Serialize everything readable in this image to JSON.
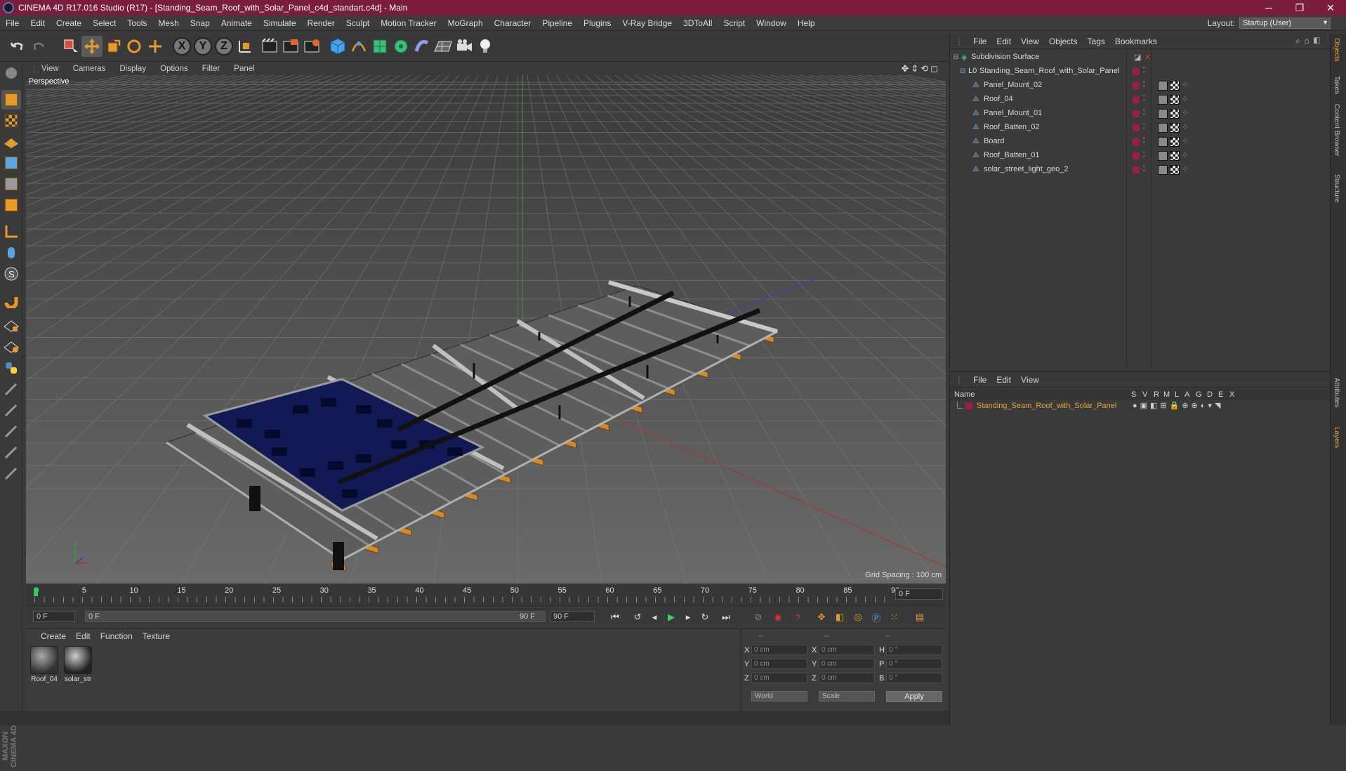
{
  "window": {
    "title": "CINEMA 4D R17.016 Studio (R17) - [Standing_Seam_Roof_with_Solar_Panel_c4d_standart.c4d] - Main",
    "controls": [
      "─",
      "❐",
      "✕"
    ]
  },
  "menu": [
    "File",
    "Edit",
    "Create",
    "Select",
    "Tools",
    "Mesh",
    "Snap",
    "Animate",
    "Simulate",
    "Render",
    "Sculpt",
    "Motion Tracker",
    "MoGraph",
    "Character",
    "Pipeline",
    "Plugins",
    "V-Ray Bridge",
    "3DToAll",
    "Script",
    "Window",
    "Help"
  ],
  "layout": {
    "label": "Layout:",
    "value": "Startup (User)"
  },
  "viewport": {
    "menu": [
      "View",
      "Cameras",
      "Display",
      "Options",
      "Filter",
      "Panel"
    ],
    "camera_label": "Perspective",
    "grid_spacing": "Grid Spacing : 100 cm",
    "nav_icons": "✥⇕⟲◻"
  },
  "timeline": {
    "ticks": [
      "0",
      "5",
      "10",
      "15",
      "20",
      "25",
      "30",
      "35",
      "40",
      "45",
      "50",
      "55",
      "60",
      "65",
      "70",
      "75",
      "80",
      "85",
      "90"
    ],
    "current_frame": "0 F"
  },
  "playback": {
    "start_field": "0 F",
    "range_start": "0 F",
    "range_end": "90 F",
    "end_field": "90 F"
  },
  "materials": {
    "menu": [
      "Create",
      "Edit",
      "Function",
      "Texture"
    ],
    "items": [
      "Roof_04",
      "solar_str"
    ]
  },
  "coords": {
    "headers": [
      "--",
      "--",
      "--"
    ],
    "rows": [
      {
        "a": "X",
        "av": "0 cm",
        "b": "X",
        "bv": "0 cm",
        "c": "H",
        "cv": "0 °"
      },
      {
        "a": "Y",
        "av": "0 cm",
        "b": "Y",
        "bv": "0 cm",
        "c": "P",
        "cv": "0 °"
      },
      {
        "a": "Z",
        "av": "0 cm",
        "b": "Z",
        "bv": "0 cm",
        "c": "B",
        "cv": "0 °"
      }
    ],
    "mode1": "World",
    "mode2": "Scale",
    "apply": "Apply"
  },
  "objects": {
    "menu": [
      "File",
      "Edit",
      "View",
      "Objects",
      "Tags",
      "Bookmarks"
    ],
    "tree": [
      {
        "name": "Subdivision Surface",
        "level": 0
      },
      {
        "name": "Standing_Seam_Roof_with_Solar_Panel",
        "level": 1
      },
      {
        "name": "Panel_Mount_02",
        "level": 2
      },
      {
        "name": "Roof_04",
        "level": 2
      },
      {
        "name": "Panel_Mount_01",
        "level": 2
      },
      {
        "name": "Roof_Batten_02",
        "level": 2
      },
      {
        "name": "Board",
        "level": 2
      },
      {
        "name": "Roof_Batten_01",
        "level": 2
      },
      {
        "name": "solar_street_light_geo_2",
        "level": 2
      }
    ]
  },
  "layers": {
    "menu": [
      "File",
      "Edit",
      "View"
    ],
    "columns": [
      "Name",
      "S",
      "V",
      "R",
      "M",
      "L",
      "A",
      "G",
      "D",
      "E",
      "X"
    ],
    "row": "Standing_Seam_Roof_with_Solar_Panel"
  },
  "right_tabs": [
    "Objects",
    "Takes",
    "Content Browser",
    "Structure",
    "Attributes",
    "Layers"
  ],
  "colors": {
    "title_bar": "#7b1e3d",
    "accent_orange": "#e69a2c",
    "layer_red": "#9c1f43",
    "solar_blue": "#111a55"
  },
  "branding": "MAXON CINEMA 4D"
}
